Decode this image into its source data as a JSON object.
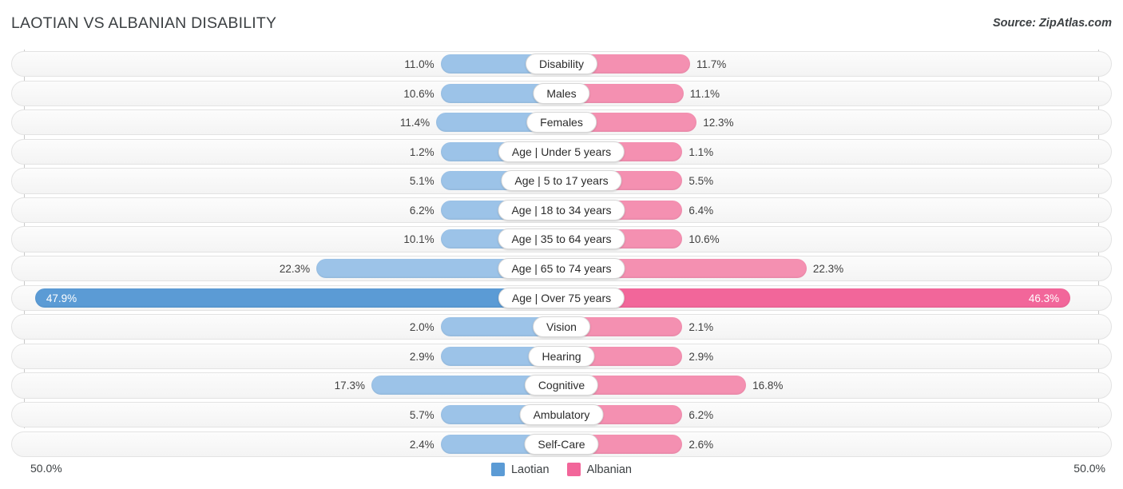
{
  "header": {
    "title": "LAOTIAN VS ALBANIAN DISABILITY",
    "source": "Source: ZipAtlas.com"
  },
  "legend": {
    "items": [
      {
        "label": "Laotian",
        "color": "#5B9BD5"
      },
      {
        "label": "Albanian",
        "color": "#F2669A"
      }
    ]
  },
  "axis": {
    "left_label": "50.0%",
    "right_label": "50.0%",
    "max": 50.0
  },
  "colors": {
    "laotian_light": "#9CC3E8",
    "laotian_strong": "#5B9BD5",
    "albanian_light": "#F490B1",
    "albanian_strong": "#F2669A",
    "row_track": "#f4f4f4",
    "text": "#404040"
  },
  "chart_data": {
    "type": "bar",
    "orientation": "diverging-horizontal",
    "title": "LAOTIAN VS ALBANIAN DISABILITY",
    "xlabel": "",
    "ylabel": "",
    "xlim": [
      50.0,
      50.0
    ],
    "grid": false,
    "legend_position": "bottom-center",
    "categories": [
      "Disability",
      "Males",
      "Females",
      "Age | Under 5 years",
      "Age | 5 to 17 years",
      "Age | 18 to 34 years",
      "Age | 35 to 64 years",
      "Age | 65 to 74 years",
      "Age | Over 75 years",
      "Vision",
      "Hearing",
      "Cognitive",
      "Ambulatory",
      "Self-Care"
    ],
    "series": [
      {
        "name": "Laotian",
        "values": [
          11.0,
          10.6,
          11.4,
          1.2,
          5.1,
          6.2,
          10.1,
          22.3,
          47.9,
          2.0,
          2.9,
          17.3,
          5.7,
          2.4
        ],
        "labels": [
          "11.0%",
          "10.6%",
          "11.4%",
          "1.2%",
          "5.1%",
          "6.2%",
          "10.1%",
          "22.3%",
          "47.9%",
          "2.0%",
          "2.9%",
          "17.3%",
          "5.7%",
          "2.4%"
        ]
      },
      {
        "name": "Albanian",
        "values": [
          11.7,
          11.1,
          12.3,
          1.1,
          5.5,
          6.4,
          10.6,
          22.3,
          46.3,
          2.1,
          2.9,
          16.8,
          6.2,
          2.6
        ],
        "labels": [
          "11.7%",
          "11.1%",
          "12.3%",
          "1.1%",
          "5.5%",
          "6.4%",
          "10.6%",
          "22.3%",
          "46.3%",
          "2.1%",
          "2.9%",
          "16.8%",
          "6.2%",
          "2.6%"
        ]
      }
    ],
    "highlighted_row_index": 8
  }
}
